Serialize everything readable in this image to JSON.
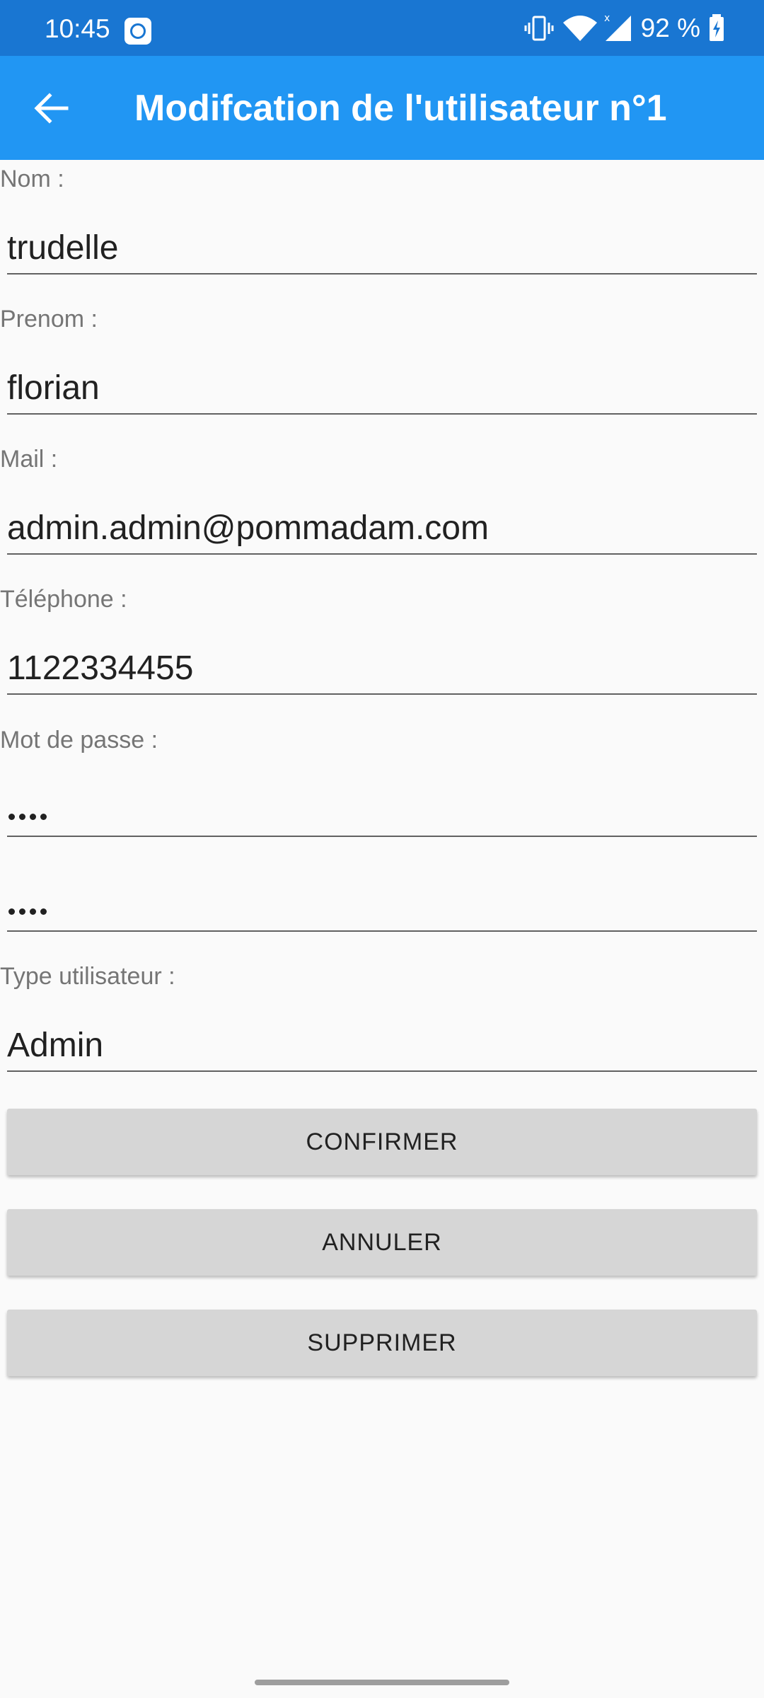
{
  "status_bar": {
    "time": "10:45",
    "battery": "92 %",
    "icons": [
      "app-notification-icon",
      "vibrate-icon",
      "wifi-icon",
      "signal-icon",
      "battery-charging-icon"
    ],
    "color": "#1976d2"
  },
  "app_bar": {
    "title": "Modifcation de l'utilisateur n°1",
    "back_icon": "arrow-left-icon",
    "color": "#2196f3"
  },
  "form": {
    "nom": {
      "label": "Nom :",
      "value": "trudelle"
    },
    "prenom": {
      "label": "Prenom :",
      "value": "florian"
    },
    "mail": {
      "label": "Mail :",
      "value": "admin.admin@pommadam.com"
    },
    "telephone": {
      "label": "Téléphone :",
      "value": "1122334455"
    },
    "mot_de_passe": {
      "label": "Mot de passe :",
      "masked_length": 4
    },
    "confirm_password": {
      "masked_length": 4
    },
    "type_utilisateur": {
      "label": "Type utilisateur :",
      "value": "Admin"
    }
  },
  "buttons": {
    "confirmer": "CONFIRMER",
    "annuler": "ANNULER",
    "supprimer": "SUPPRIMER"
  }
}
